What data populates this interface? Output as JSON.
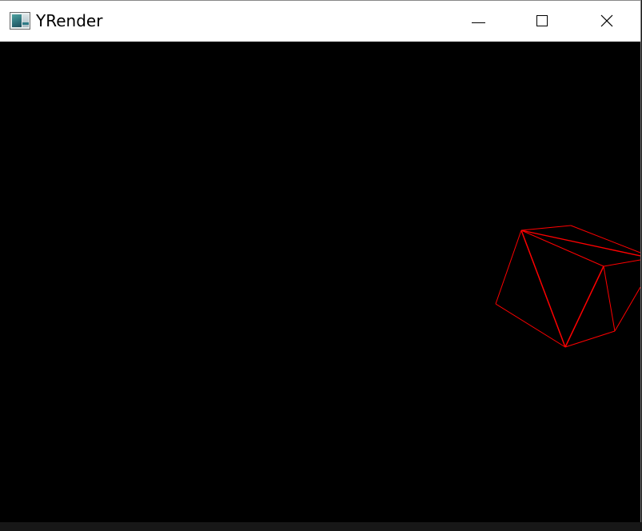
{
  "window": {
    "title": "YRender",
    "icon": "app-window-icon",
    "controls": {
      "minimize": "minimize-icon",
      "maximize": "maximize-icon",
      "close": "close-icon"
    }
  },
  "viewport": {
    "background": "#000000",
    "wireframe_color": "#ff0000"
  }
}
